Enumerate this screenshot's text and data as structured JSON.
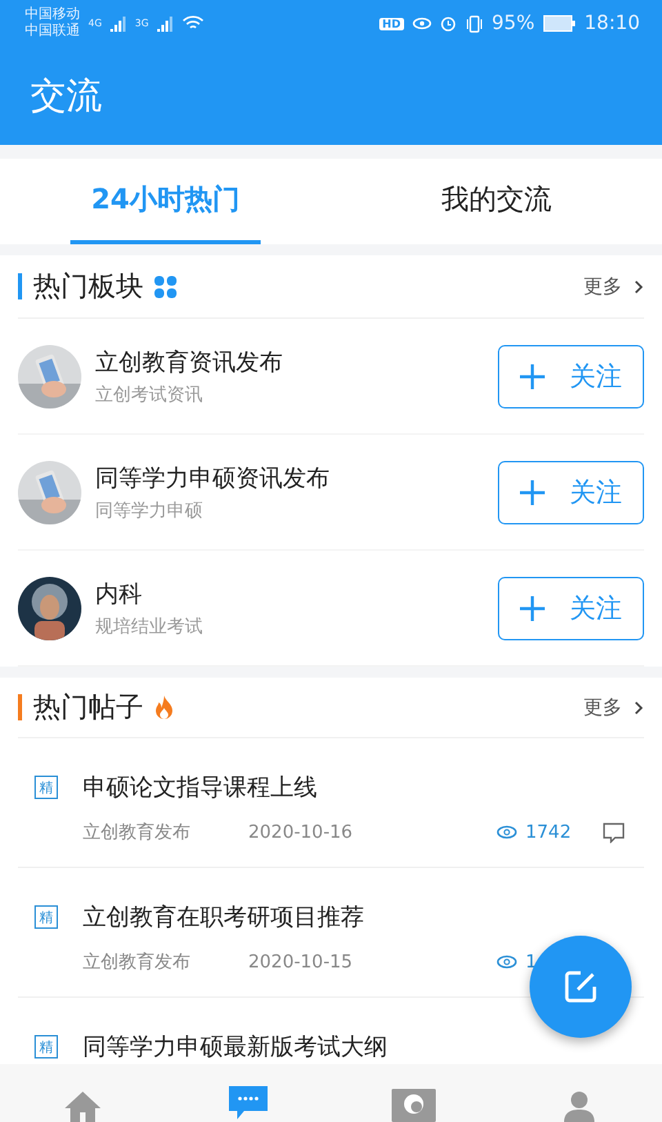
{
  "status_bar": {
    "carriers": [
      "中国移动",
      "中国联通"
    ],
    "networks": [
      "4G",
      "3G"
    ],
    "hd": "HD",
    "battery": "95%",
    "time": "18:10"
  },
  "app_bar": {
    "title": "交流"
  },
  "tabs": [
    {
      "label": "24小时热门",
      "selected": true
    },
    {
      "label": "我的交流",
      "selected": false
    }
  ],
  "hot_boards": {
    "title": "热门板块",
    "more": "更多",
    "items": [
      {
        "name": "立创教育资讯发布",
        "subtitle": "立创考试资讯",
        "kind": "picture",
        "button": "关注"
      },
      {
        "name": "同等学力申硕资讯发布",
        "subtitle": "同等学力申硕",
        "kind": "picture",
        "button": "关注"
      },
      {
        "name": "内科",
        "subtitle": "规培结业考试",
        "kind": "picture",
        "button": "关注"
      }
    ]
  },
  "hot_posts": {
    "title": "热门帖子",
    "more": "更多",
    "items": [
      {
        "badge": "精",
        "title": "申硕论文指导课程上线",
        "author": "立创教育发布",
        "date": "2020-10-16",
        "views": "1742"
      },
      {
        "badge": "精",
        "title": "立创教育在职考研项目推荐",
        "author": "立创教育发布",
        "date": "2020-10-15",
        "views": "1"
      },
      {
        "badge": "精",
        "title": "同等学力申硕最新版考试大纲"
      }
    ]
  },
  "bottom_nav": [
    {
      "kind": "home",
      "selected": false
    },
    {
      "kind": "chat",
      "selected": true
    },
    {
      "kind": "camera",
      "selected": false
    },
    {
      "kind": "user",
      "selected": false
    }
  ]
}
